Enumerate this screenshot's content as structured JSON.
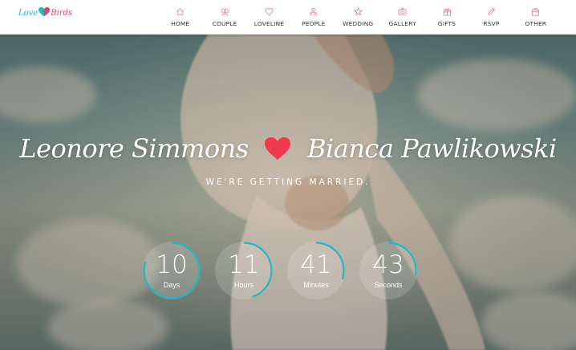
{
  "logo": {
    "word1": "Love",
    "word2": "Birds"
  },
  "nav": [
    {
      "label": "HOME",
      "icon": "home-icon"
    },
    {
      "label": "COUPLE",
      "icon": "couple-icon"
    },
    {
      "label": "LOVELINE",
      "icon": "heart-icon"
    },
    {
      "label": "PEOPLE",
      "icon": "people-icon"
    },
    {
      "label": "WEDDING",
      "icon": "star-icon"
    },
    {
      "label": "GALLERY",
      "icon": "camera-icon"
    },
    {
      "label": "GIFTS",
      "icon": "gift-icon"
    },
    {
      "label": "RSVP",
      "icon": "pencil-icon"
    },
    {
      "label": "OTHER",
      "icon": "bag-icon"
    }
  ],
  "hero": {
    "groom": "Leonore Simmons",
    "bride": "Bianca Pawlikowski",
    "tagline": "WE'RE GETTING MARRIED."
  },
  "countdown": [
    {
      "value": "10",
      "unit": "Days",
      "progress": 0.8
    },
    {
      "value": "11",
      "unit": "Hours",
      "progress": 0.45
    },
    {
      "value": "41",
      "unit": "Minutes",
      "progress": 0.3
    },
    {
      "value": "43",
      "unit": "Seconds",
      "progress": 0.28
    }
  ],
  "colors": {
    "accent": "#e6406a",
    "ring": "#21b5c8",
    "teal": "#2bb3c0",
    "nav_icon": "#e57a95"
  }
}
